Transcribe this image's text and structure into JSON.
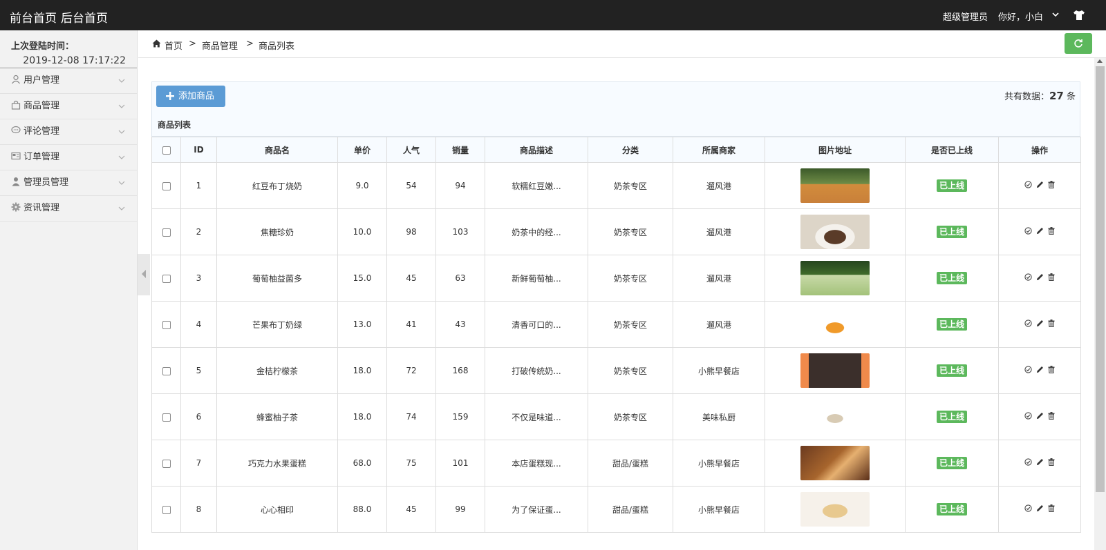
{
  "topbar": {
    "front_home": "前台首页",
    "back_home": "后台首页",
    "role": "超级管理员",
    "greeting": "你好，小白"
  },
  "sidebar": {
    "login_label": "上次登陆时间：",
    "login_time": "2019-12-08 17:17:22",
    "items": [
      {
        "label": "用户管理",
        "icon": "user-icon"
      },
      {
        "label": "商品管理",
        "icon": "shopping-bag-icon"
      },
      {
        "label": "评论管理",
        "icon": "comment-icon"
      },
      {
        "label": "订单管理",
        "icon": "order-icon"
      },
      {
        "label": "管理员管理",
        "icon": "admin-user-icon"
      },
      {
        "label": "资讯管理",
        "icon": "gear-icon"
      }
    ]
  },
  "breadcrumb": {
    "home": "首页",
    "sep1": ">",
    "level1": "商品管理",
    "sep2": ">",
    "level2": "商品列表"
  },
  "toolbar": {
    "add_label": "添加商品",
    "total_prefix": "共有数据：",
    "total_count": "27",
    "total_suffix": " 条"
  },
  "table": {
    "caption": "商品列表",
    "headers": [
      "ID",
      "商品名",
      "单价",
      "人气",
      "销量",
      "商品描述",
      "分类",
      "所属商家",
      "图片地址",
      "是否已上线",
      "操作"
    ],
    "rows": [
      {
        "id": "1",
        "name": "红豆布丁烧奶",
        "price": "9.0",
        "popularity": "54",
        "sales": "94",
        "desc": "软糯红豆嫩...",
        "category": "奶茶专区",
        "merchant": "遛风港",
        "status": "已上线"
      },
      {
        "id": "2",
        "name": "焦糖珍奶",
        "price": "10.0",
        "popularity": "98",
        "sales": "103",
        "desc": "奶茶中的经...",
        "category": "奶茶专区",
        "merchant": "遛风港",
        "status": "已上线"
      },
      {
        "id": "3",
        "name": "葡萄柚益菌多",
        "price": "15.0",
        "popularity": "45",
        "sales": "63",
        "desc": "新鲜葡萄柚...",
        "category": "奶茶专区",
        "merchant": "遛风港",
        "status": "已上线"
      },
      {
        "id": "4",
        "name": "芒果布丁奶绿",
        "price": "13.0",
        "popularity": "41",
        "sales": "43",
        "desc": "清香可口的...",
        "category": "奶茶专区",
        "merchant": "遛风港",
        "status": "已上线"
      },
      {
        "id": "5",
        "name": "金桔柠檬茶",
        "price": "18.0",
        "popularity": "72",
        "sales": "168",
        "desc": "打破传统奶...",
        "category": "奶茶专区",
        "merchant": "小熊早餐店",
        "status": "已上线"
      },
      {
        "id": "6",
        "name": "蜂蜜柚子茶",
        "price": "18.0",
        "popularity": "74",
        "sales": "159",
        "desc": "不仅是味道...",
        "category": "奶茶专区",
        "merchant": "美味私厨",
        "status": "已上线"
      },
      {
        "id": "7",
        "name": "巧克力水果蛋糕",
        "price": "68.0",
        "popularity": "75",
        "sales": "101",
        "desc": "本店蛋糕现...",
        "category": "甜品/蛋糕",
        "merchant": "小熊早餐店",
        "status": "已上线"
      },
      {
        "id": "8",
        "name": "心心相印",
        "price": "88.0",
        "popularity": "45",
        "sales": "99",
        "desc": "为了保证蛋...",
        "category": "甜品/蛋糕",
        "merchant": "小熊早餐店",
        "status": "已上线"
      }
    ]
  },
  "colors": {
    "topbar_bg": "#222222",
    "primary_button": "#5b9bd5",
    "success": "#5cb85c"
  }
}
